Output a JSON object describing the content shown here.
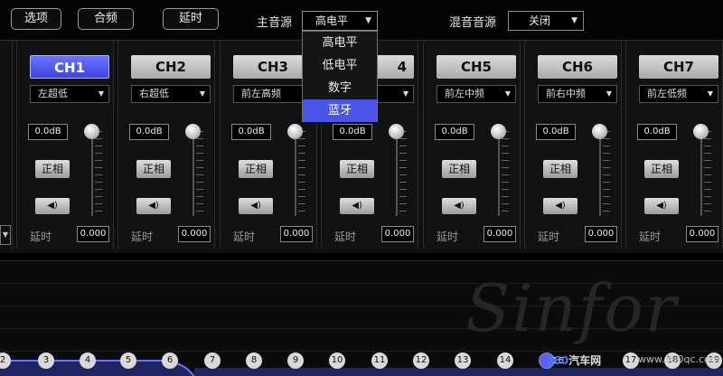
{
  "toolbar": {
    "options_label": "选项",
    "combine_label": "合频",
    "delay_label": "延时",
    "main_source_label": "主音源",
    "main_source_value": "高电平",
    "mix_source_label": "混音音源",
    "mix_source_value": "关闭"
  },
  "dropdown": {
    "items": [
      "高电平",
      "低电平",
      "数字",
      "蓝牙"
    ],
    "selected": "蓝牙"
  },
  "channels": [
    {
      "name": "CH1",
      "speaker": "左超低",
      "gain": "0.0dB",
      "phase": "正相",
      "delay_label": "延时",
      "delay": "0.000",
      "active": true
    },
    {
      "name": "CH2",
      "speaker": "右超低",
      "gain": "0.0dB",
      "phase": "正相",
      "delay_label": "延时",
      "delay": "0.000",
      "active": false
    },
    {
      "name": "CH3",
      "speaker": "前左高频",
      "gain": "0.0dB",
      "phase": "正相",
      "delay_label": "延时",
      "delay": "0.000",
      "active": false
    },
    {
      "name": "4",
      "speaker": "",
      "gain": "0.0dB",
      "phase": "正相",
      "delay_label": "延时",
      "delay": "0.000",
      "active": false
    },
    {
      "name": "CH5",
      "speaker": "前左中频",
      "gain": "0.0dB",
      "phase": "正相",
      "delay_label": "延时",
      "delay": "0.000",
      "active": false
    },
    {
      "name": "CH6",
      "speaker": "前右中频",
      "gain": "0.0dB",
      "phase": "正相",
      "delay_label": "延时",
      "delay": "0.000",
      "active": false
    },
    {
      "name": "CH7",
      "speaker": "前左低频",
      "gain": "0.0dB",
      "phase": "正相",
      "delay_label": "延时",
      "delay": "0.000",
      "active": false
    }
  ],
  "eq": {
    "watermark": "Sinfor",
    "bands": [
      "2",
      "3",
      "4",
      "5",
      "6",
      "7",
      "8",
      "9",
      "10",
      "11",
      "12",
      "13",
      "14",
      "16",
      "17",
      "18",
      "19"
    ],
    "brand_prefix": "360",
    "brand_suffix": "汽车网",
    "url": "www.360qc.com"
  },
  "colors": {
    "accent": "#4b54e8",
    "eq_fill": "#1e2563"
  },
  "icons": {
    "mute": "speaker-icon",
    "caret": "chevron-down-icon"
  }
}
